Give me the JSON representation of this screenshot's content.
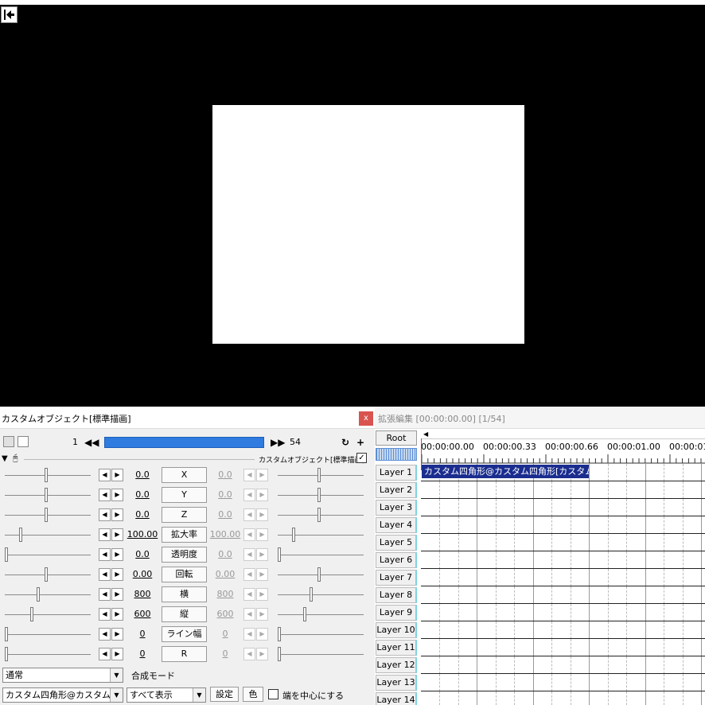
{
  "preview": {
    "back_icon": "arrow-left-bar-icon"
  },
  "property_panel": {
    "title": "カスタムオブジェクト[標準描画]",
    "close_label": "x",
    "frame_start": "1",
    "frame_end": "54",
    "object_label": "カスタムオブジェクト[標準描画]",
    "object_enabled_mark": "✓",
    "params": [
      {
        "name": "X",
        "left_value": "0.0",
        "right_value": "0.0",
        "left_pos": 0.5,
        "right_pos": 0.5
      },
      {
        "name": "Y",
        "left_value": "0.0",
        "right_value": "0.0",
        "left_pos": 0.5,
        "right_pos": 0.5
      },
      {
        "name": "Z",
        "left_value": "0.0",
        "right_value": "0.0",
        "left_pos": 0.5,
        "right_pos": 0.5
      },
      {
        "name": "拡大率",
        "left_value": "100.00",
        "right_value": "100.00",
        "left_pos": 0.18,
        "right_pos": 0.18
      },
      {
        "name": "透明度",
        "left_value": "0.0",
        "right_value": "0.0",
        "left_pos": 0.0,
        "right_pos": 0.0
      },
      {
        "name": "回転",
        "left_value": "0.00",
        "right_value": "0.00",
        "left_pos": 0.5,
        "right_pos": 0.5
      },
      {
        "name": "横",
        "left_value": "800",
        "right_value": "800",
        "left_pos": 0.4,
        "right_pos": 0.4
      },
      {
        "name": "縦",
        "left_value": "600",
        "right_value": "600",
        "left_pos": 0.32,
        "right_pos": 0.32
      },
      {
        "name": "ライン幅",
        "left_value": "0",
        "right_value": "0",
        "left_pos": 0.0,
        "right_pos": 0.0
      },
      {
        "name": "R",
        "left_value": "0",
        "right_value": "0",
        "left_pos": 0.0,
        "right_pos": 0.0
      }
    ],
    "blend_mode_value": "通常",
    "blend_mode_label": "合成モード",
    "shape_value": "カスタム四角形@カスタム四角",
    "display_value": "すべて表示",
    "settings_label": "設定",
    "color_label": "色",
    "center_edge_label": "端を中心にする"
  },
  "timeline": {
    "title": "拡張編集 [00:00:00.00] [1/54]",
    "root_label": "Root",
    "timecodes": [
      "00:00:00.00",
      "00:00:00.33",
      "00:00:00.66",
      "00:00:01.00",
      "00:00:01."
    ],
    "layers": [
      "Layer 1",
      "Layer 2",
      "Layer 3",
      "Layer 4",
      "Layer 5",
      "Layer 6",
      "Layer 7",
      "Layer 8",
      "Layer 9",
      "Layer 10",
      "Layer 11",
      "Layer 12",
      "Layer 13",
      "Layer 14"
    ],
    "clip_label": "カスタム四角形@カスタム四角形[カスタムオブ"
  },
  "colors": {
    "accent": "#2f7be0",
    "clip": "#1a2d8f",
    "close": "#d9534f"
  }
}
